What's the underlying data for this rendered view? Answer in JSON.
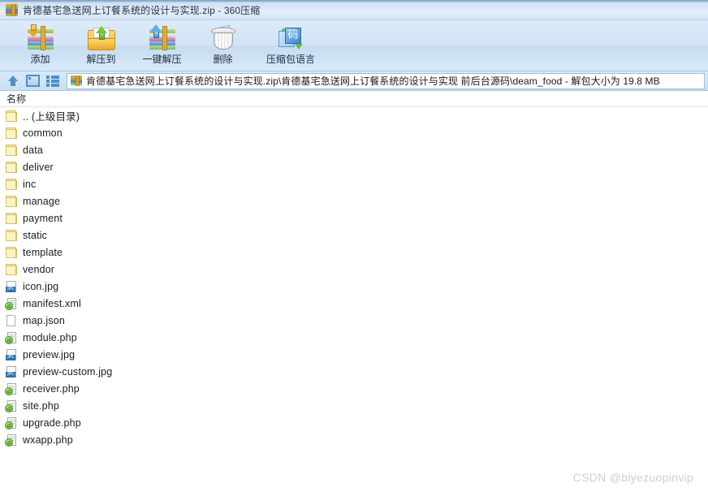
{
  "titlebar": {
    "icon": "archive-icon",
    "title": "肯德基宅急送网上订餐系统的设计与实现.zip - 360压缩"
  },
  "toolbar": {
    "buttons": [
      {
        "id": "add",
        "label": "添加",
        "icon": "add-archive-icon"
      },
      {
        "id": "extract_to",
        "label": "解压到",
        "icon": "extract-to-folder-icon"
      },
      {
        "id": "one_click",
        "label": "一键解压",
        "icon": "one-click-extract-icon"
      },
      {
        "id": "delete",
        "label": "删除",
        "icon": "trash-icon"
      },
      {
        "id": "archive_lang",
        "label": "压缩包语言",
        "icon": "encoding-icon",
        "glyph": "码"
      }
    ]
  },
  "addressbar": {
    "nav": [
      {
        "id": "up",
        "icon": "up-arrow-icon"
      },
      {
        "id": "preview",
        "icon": "window-preview-icon"
      },
      {
        "id": "list_view",
        "icon": "list-view-icon"
      }
    ],
    "icon": "archive-icon",
    "path": "肯德基宅急送网上订餐系统的设计与实现.zip\\肯德基宅急送网上订餐系统的设计与实现 前后台源码\\deam_food - 解包大小为 19.8 MB"
  },
  "list": {
    "columns": [
      "名称"
    ],
    "rows": [
      {
        "name": ".. (上级目录)",
        "icon": "folder-icon"
      },
      {
        "name": "common",
        "icon": "folder-icon"
      },
      {
        "name": "data",
        "icon": "folder-icon"
      },
      {
        "name": "deliver",
        "icon": "folder-icon"
      },
      {
        "name": "inc",
        "icon": "folder-icon"
      },
      {
        "name": "manage",
        "icon": "folder-icon"
      },
      {
        "name": "payment",
        "icon": "folder-icon"
      },
      {
        "name": "static",
        "icon": "folder-icon"
      },
      {
        "name": "template",
        "icon": "folder-icon"
      },
      {
        "name": "vendor",
        "icon": "folder-icon"
      },
      {
        "name": "icon.jpg",
        "icon": "jpg-file-icon"
      },
      {
        "name": "manifest.xml",
        "icon": "php-file-icon"
      },
      {
        "name": "map.json",
        "icon": "document-file-icon"
      },
      {
        "name": "module.php",
        "icon": "php-file-icon"
      },
      {
        "name": "preview.jpg",
        "icon": "jpg-file-icon"
      },
      {
        "name": "preview-custom.jpg",
        "icon": "jpg-file-icon"
      },
      {
        "name": "receiver.php",
        "icon": "php-file-icon"
      },
      {
        "name": "site.php",
        "icon": "php-file-icon"
      },
      {
        "name": "upgrade.php",
        "icon": "php-file-icon"
      },
      {
        "name": "wxapp.php",
        "icon": "php-file-icon"
      }
    ]
  },
  "watermark": {
    "text": "CSDN @biyezuopinvip"
  },
  "colors": {
    "titlebar_start": "#c9dcf0",
    "toolbar": "#d2e4f6",
    "border": "#a9c6e2",
    "folder_fill": "#fdf4c4",
    "folder_stroke": "#d8c068",
    "jpg_tag": "#2f6fa8",
    "php_badge": "#5aab28",
    "watermark": "#cfcfcf"
  }
}
